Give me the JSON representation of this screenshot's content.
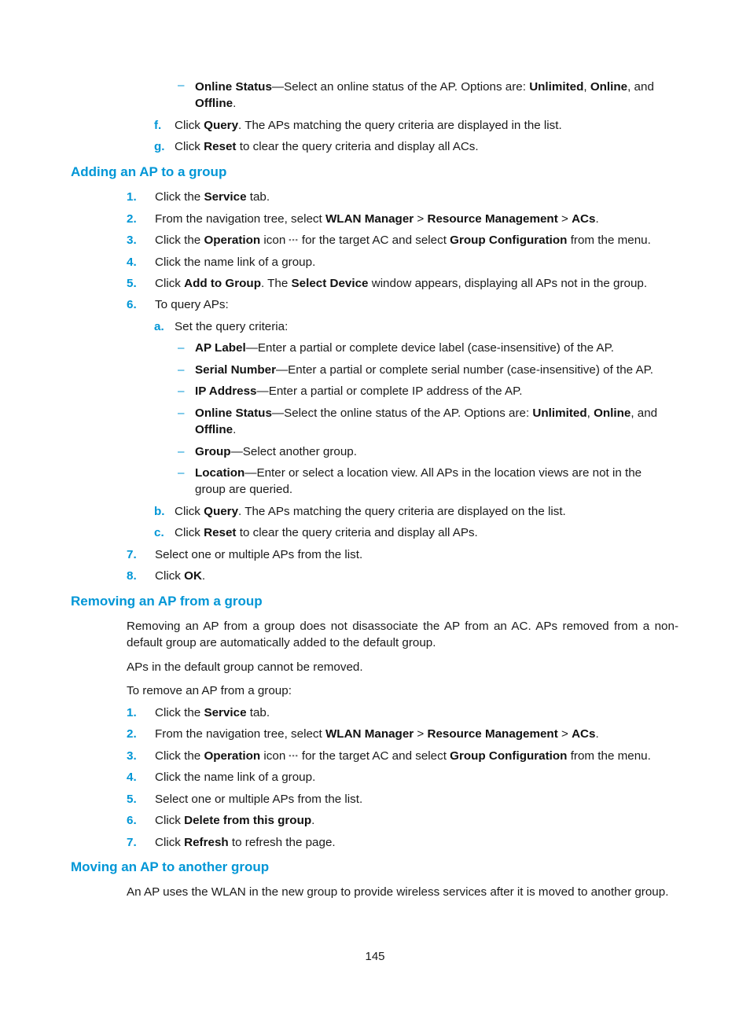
{
  "accent_color": "#0096d6",
  "top_items": {
    "online_status": {
      "label": "Online Status",
      "text": "—Select an online status of the AP. Options are: ",
      "opt1": "Unlimited",
      "sep1": ", ",
      "opt2": "Online",
      "sep2": ", and",
      "opt3": "Offline",
      "end": "."
    },
    "f": {
      "marker": "f.",
      "pre": "Click ",
      "bold": "Query",
      "post": ". The APs matching the query criteria are displayed in the list."
    },
    "g": {
      "marker": "g.",
      "pre": "Click ",
      "bold": "Reset",
      "post": " to clear the query criteria and display all ACs."
    }
  },
  "section_add": {
    "heading": "Adding an AP to a group",
    "steps": [
      {
        "num": "1.",
        "pre": "Click the ",
        "b1": "Service",
        "post": " tab."
      },
      {
        "num": "2.",
        "pre": "From the navigation tree, select ",
        "b1": "WLAN Manager",
        "s1": " > ",
        "b2": "Resource Management",
        "s2": " > ",
        "b3": "ACs",
        "post": "."
      },
      {
        "num": "3.",
        "pre": "Click the ",
        "b1": "Operation",
        "mid": " icon",
        "icon": "▪▪▪",
        "mid2": "for the target AC and select ",
        "b2": "Group Configuration",
        "post": " from the menu."
      },
      {
        "num": "4.",
        "text": "Click the name link of a group."
      },
      {
        "num": "5.",
        "pre": "Click ",
        "b1": "Add to Group",
        "mid": ". The ",
        "b2": "Select Device",
        "post": " window appears, displaying all APs not in the group."
      },
      {
        "num": "6.",
        "text": "To query APs:"
      }
    ],
    "sub_a": {
      "marker": "a.",
      "text": "Set the query criteria:"
    },
    "criteria": [
      {
        "label": "AP Label",
        "text": "—Enter a partial or complete device label (case-insensitive) of the AP."
      },
      {
        "label": "Serial Number",
        "text": "—Enter a partial or complete serial number (case-insensitive) of the AP."
      },
      {
        "label": "IP Address",
        "text": "—Enter a partial or complete IP address of the AP."
      },
      {
        "label": "Online Status",
        "text": "—Select the online status of the AP. Options are: ",
        "opt1": "Unlimited",
        "sep1": ", ",
        "opt2": "Online",
        "sep2": ", and",
        "opt3": "Offline",
        "end": "."
      },
      {
        "label": "Group",
        "text": "—Select another group."
      },
      {
        "label": "Location",
        "text": "—Enter or select a location view. All APs in the location views are not in the",
        "text2": "group are queried."
      }
    ],
    "sub_b": {
      "marker": "b.",
      "pre": "Click ",
      "bold": "Query",
      "post": ". The APs matching the query criteria are displayed on the list."
    },
    "sub_c": {
      "marker": "c.",
      "pre": "Click ",
      "bold": "Reset",
      "post": " to clear the query criteria and display all APs."
    },
    "step7": {
      "num": "7.",
      "text": "Select one or multiple APs from the list."
    },
    "step8": {
      "num": "8.",
      "pre": "Click ",
      "bold": "OK",
      "post": "."
    }
  },
  "section_remove": {
    "heading": "Removing an AP from a group",
    "para1": "Removing an AP from a group does not disassociate the AP from an AC. APs removed from a non-default group are automatically added to the default group.",
    "para2": "APs in the default group cannot be removed.",
    "para3": "To remove an AP from a group:",
    "steps": [
      {
        "num": "1.",
        "pre": "Click the ",
        "b1": "Service",
        "post": " tab."
      },
      {
        "num": "2.",
        "pre": "From the navigation tree, select ",
        "b1": "WLAN Manager",
        "s1": " > ",
        "b2": "Resource Management",
        "s2": " > ",
        "b3": "ACs",
        "post": "."
      },
      {
        "num": "3.",
        "pre": "Click the ",
        "b1": "Operation",
        "mid": " icon",
        "icon": "▪▪▪",
        "mid2": "for the target AC and select ",
        "b2": "Group Configuration",
        "post": " from the menu."
      },
      {
        "num": "4.",
        "text": "Click the name link of a group."
      },
      {
        "num": "5.",
        "text": "Select one or multiple APs from the list."
      },
      {
        "num": "6.",
        "pre": "Click ",
        "b1": "Delete from this group",
        "post": "."
      },
      {
        "num": "7.",
        "pre": "Click ",
        "b1": "Refresh",
        "post": " to refresh the page."
      }
    ]
  },
  "section_move": {
    "heading": "Moving an AP to another group",
    "para1": "An AP uses the WLAN in the new group to provide wireless services after it is moved to another group."
  },
  "page_number": "145"
}
